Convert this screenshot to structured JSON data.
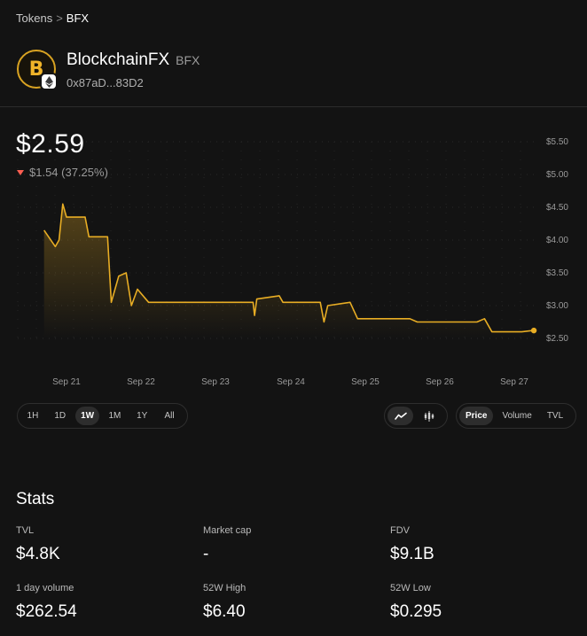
{
  "breadcrumb": {
    "parent": "Tokens",
    "separator": ">",
    "current": "BFX"
  },
  "token": {
    "name": "BlockchainFX",
    "symbol": "BFX",
    "address": "0x87aD...83D2",
    "logo_letter": "B",
    "chain_icon": "ethereum-icon",
    "brand_color": "#f0b429"
  },
  "price": {
    "current": "$2.59",
    "change": "$1.54 (37.25%)",
    "direction": "down",
    "change_color": "#ff5f52"
  },
  "chart_data": {
    "type": "line",
    "y_ticks": [
      "$5.50",
      "$5.00",
      "$4.50",
      "$4.00",
      "$3.50",
      "$3.00",
      "$2.50"
    ],
    "x_ticks": [
      "Sep 21",
      "Sep 22",
      "Sep 23",
      "Sep 24",
      "Sep 25",
      "Sep 26",
      "Sep 27"
    ],
    "ylim": [
      2.5,
      5.5
    ],
    "line_color": "#e8ad24",
    "grid": "dotted",
    "points": [
      [
        20.7,
        4.15
      ],
      [
        20.85,
        3.9
      ],
      [
        20.9,
        4.0
      ],
      [
        20.95,
        4.55
      ],
      [
        21.0,
        4.35
      ],
      [
        21.25,
        4.35
      ],
      [
        21.3,
        4.05
      ],
      [
        21.55,
        4.05
      ],
      [
        21.6,
        3.05
      ],
      [
        21.7,
        3.45
      ],
      [
        21.8,
        3.5
      ],
      [
        21.87,
        3.0
      ],
      [
        21.95,
        3.25
      ],
      [
        22.1,
        3.05
      ],
      [
        22.9,
        3.05
      ],
      [
        23.5,
        3.05
      ],
      [
        23.52,
        2.85
      ],
      [
        23.55,
        3.1
      ],
      [
        23.85,
        3.15
      ],
      [
        23.9,
        3.05
      ],
      [
        24.4,
        3.05
      ],
      [
        24.45,
        2.75
      ],
      [
        24.5,
        3.0
      ],
      [
        24.8,
        3.05
      ],
      [
        24.9,
        2.8
      ],
      [
        25.6,
        2.8
      ],
      [
        25.7,
        2.75
      ],
      [
        26.5,
        2.75
      ],
      [
        26.6,
        2.8
      ],
      [
        26.7,
        2.6
      ],
      [
        27.1,
        2.6
      ],
      [
        27.25,
        2.62
      ]
    ],
    "last_value": 2.59
  },
  "controls": {
    "ranges": [
      "1H",
      "1D",
      "1W",
      "1M",
      "1Y",
      "All"
    ],
    "active_range": "1W",
    "chart_types": [
      {
        "icon": "line-chart-icon",
        "active": true
      },
      {
        "icon": "candlestick-icon",
        "active": false
      }
    ],
    "metrics": [
      "Price",
      "Volume",
      "TVL"
    ],
    "active_metric": "Price"
  },
  "stats": {
    "title": "Stats",
    "items": [
      {
        "label": "TVL",
        "value": "$4.8K"
      },
      {
        "label": "Market cap",
        "value": "-"
      },
      {
        "label": "FDV",
        "value": "$9.1B"
      },
      {
        "label": "1 day volume",
        "value": "$262.54"
      },
      {
        "label": "52W High",
        "value": "$6.40"
      },
      {
        "label": "52W Low",
        "value": "$0.295"
      }
    ]
  }
}
